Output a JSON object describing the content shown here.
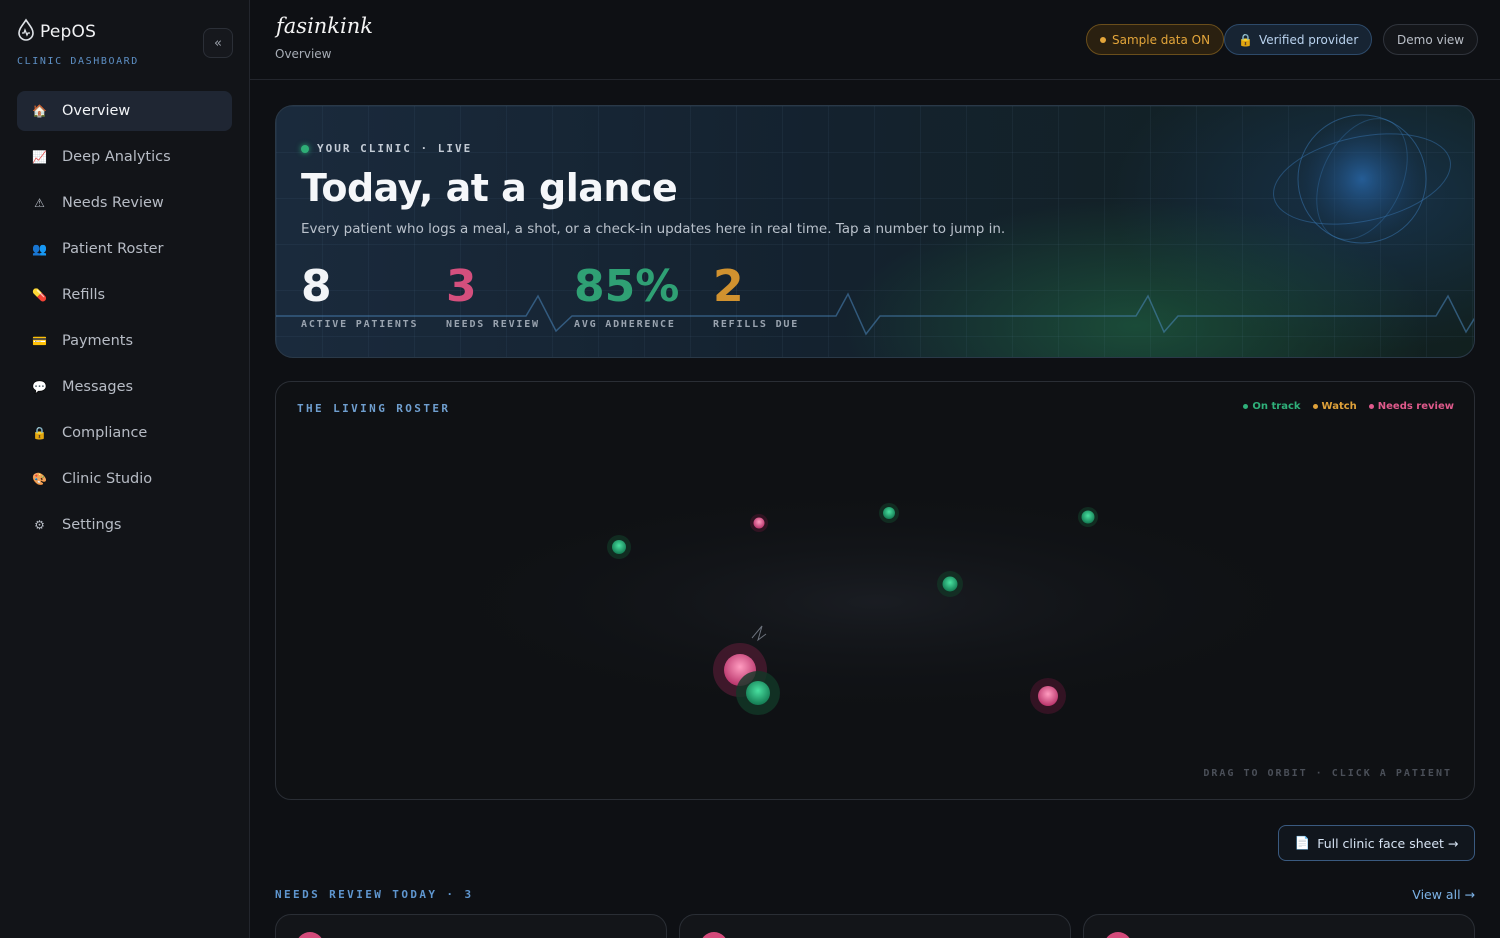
{
  "sidebar": {
    "brand": "PepOS",
    "subtitle": "CLINIC DASHBOARD",
    "collapse_label": "«",
    "items": [
      {
        "label": "Overview",
        "icon": "house-icon",
        "glyph": "🏠"
      },
      {
        "label": "Deep Analytics",
        "icon": "chart-icon",
        "glyph": "📈"
      },
      {
        "label": "Needs Review",
        "icon": "warning-icon",
        "glyph": "⚠"
      },
      {
        "label": "Patient Roster",
        "icon": "people-icon",
        "glyph": "👥"
      },
      {
        "label": "Refills",
        "icon": "pill-icon",
        "glyph": "💊"
      },
      {
        "label": "Payments",
        "icon": "card-icon",
        "glyph": "💳"
      },
      {
        "label": "Messages",
        "icon": "chat-icon",
        "glyph": "💬"
      },
      {
        "label": "Compliance",
        "icon": "lock-icon",
        "glyph": "🔒"
      },
      {
        "label": "Clinic Studio",
        "icon": "palette-icon",
        "glyph": "🎨"
      },
      {
        "label": "Settings",
        "icon": "gear-icon",
        "glyph": "⚙"
      }
    ],
    "active_index": 0
  },
  "header": {
    "clinic_logo": "fasinkink",
    "breadcrumb": "Overview",
    "sample_data": "Sample data ON",
    "verified": "Verified provider",
    "demo": "Demo view"
  },
  "hero": {
    "live_label": "YOUR CLINIC · LIVE",
    "title": "Today, at a glance",
    "description": "Every patient who logs a meal, a shot, or a check-in updates here in real time. Tap a number to jump in.",
    "stats": [
      {
        "value": "8",
        "label": "ACTIVE PATIENTS",
        "color": "#f2f4f7"
      },
      {
        "value": "3",
        "label": "NEEDS REVIEW",
        "color": "#d44f7d"
      },
      {
        "value": "85%",
        "label": "AVG ADHERENCE",
        "color": "#2fa074"
      },
      {
        "value": "2",
        "label": "REFILLS DUE",
        "color": "#d1922f"
      }
    ]
  },
  "roster": {
    "title": "THE LIVING ROSTER",
    "legend": [
      {
        "label": "On track",
        "color": "#2fb07a"
      },
      {
        "label": "Watch",
        "color": "#e0a23a"
      },
      {
        "label": "Needs review",
        "color": "#e05a8c"
      }
    ],
    "hint": "DRAG TO ORBIT · CLICK A PATIENT"
  },
  "face_sheet_button": "Full clinic face sheet →",
  "review": {
    "title": "NEEDS REVIEW TODAY · 3",
    "view_all": "View all →"
  }
}
